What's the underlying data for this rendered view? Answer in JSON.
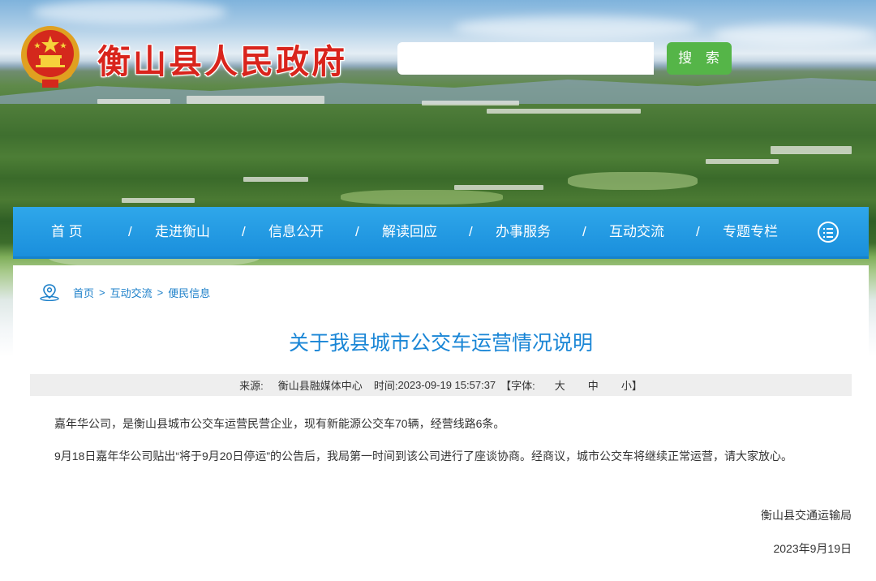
{
  "header": {
    "site_title": "衡山县人民政府",
    "search_placeholder": "",
    "search_button": "搜 索"
  },
  "nav": {
    "items": [
      "首 页",
      "走进衡山",
      "信息公开",
      "解读回应",
      "办事服务",
      "互动交流",
      "专题专栏"
    ],
    "separator": "/"
  },
  "breadcrumb": [
    "首页",
    "互动交流",
    "便民信息"
  ],
  "breadcrumb_sep": ">",
  "article": {
    "title": "关于我县城市公交车运营情况说明",
    "meta": {
      "source_label": "来源:",
      "source": "衡山县融媒体中心",
      "time_label": "时间:",
      "time": "2023-09-19 15:57:37",
      "font_label": "【字体:",
      "font_large": "大",
      "font_medium": "中",
      "font_small": "小】"
    },
    "paragraphs": [
      "嘉年华公司，是衡山县城市公交车运营民营企业，现有新能源公交车70辆，经营线路6条。",
      "9月18日嘉年华公司贴出“将于9月20日停运”的公告后，我局第一时间到该公司进行了座谈协商。经商议，城市公交车将继续正常运营，请大家放心。"
    ],
    "signature": "衡山县交通运输局",
    "date": "2023年9月19日"
  },
  "colors": {
    "title_red": "#d9241c",
    "nav_blue": "#1a8fdc",
    "search_green": "#55b548",
    "link_blue": "#1b7fc9"
  }
}
